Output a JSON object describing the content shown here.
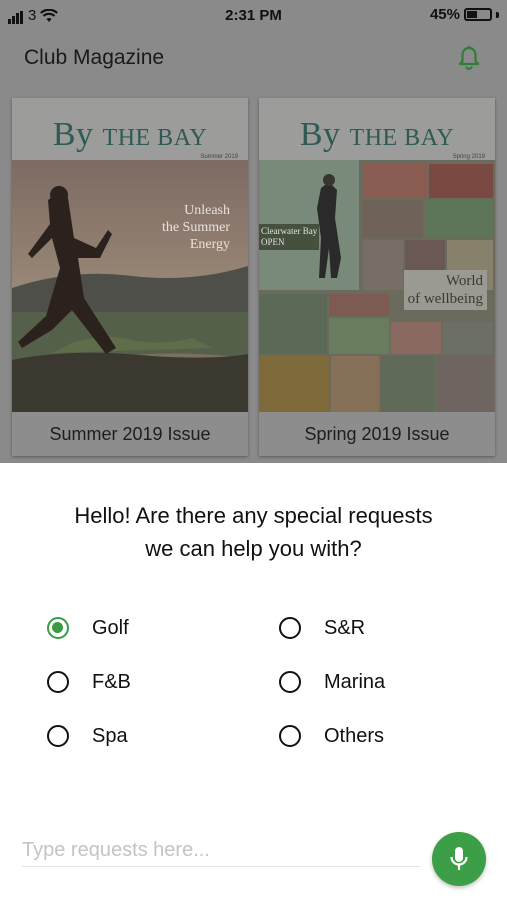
{
  "status_bar": {
    "carrier": "3",
    "time": "2:31 PM",
    "battery": "45%",
    "battery_level": 0.45
  },
  "app_bar": {
    "title": "Club Magazine",
    "notification_icon": "bell-icon"
  },
  "magazines": [
    {
      "caption": "Summer 2019 Issue",
      "cover_title_by": "By",
      "cover_title_rest": "THE BAY",
      "cover_season": "Summer 2019",
      "cover_headline": [
        "Unleash",
        "the Summer",
        "Energy"
      ]
    },
    {
      "caption": "Spring 2019 Issue",
      "cover_title_by": "By",
      "cover_title_rest": "THE BAY",
      "cover_season": "Spring 2019",
      "cover_headline": [
        "World",
        "of wellbeing"
      ],
      "cover_sign": [
        "Clearwater Bay",
        "OPEN"
      ]
    }
  ],
  "request_sheet": {
    "question_line1": "Hello! Are there any special requests",
    "question_line2": "we can help you with?",
    "options": [
      {
        "label": "Golf",
        "selected": true
      },
      {
        "label": "S&R",
        "selected": false
      },
      {
        "label": "F&B",
        "selected": false
      },
      {
        "label": "Marina",
        "selected": false
      },
      {
        "label": "Spa",
        "selected": false
      },
      {
        "label": "Others",
        "selected": false
      }
    ],
    "input_placeholder": "Type requests here...",
    "input_value": "",
    "mic_icon": "microphone-icon"
  },
  "colors": {
    "accent_green": "#3a9b45",
    "dim_overlay": "#8a8a8a"
  }
}
